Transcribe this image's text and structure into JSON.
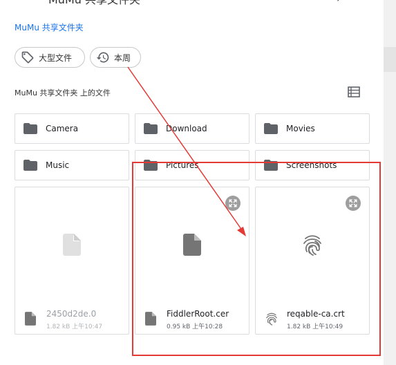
{
  "header": {
    "title": "MuMu 共享文件夹",
    "root_link": "MuMu 共享文件夹",
    "close_glyph": "↗"
  },
  "chips": [
    {
      "label": "大型文件",
      "icon": "tag-icon"
    },
    {
      "label": "本周",
      "icon": "history-icon"
    }
  ],
  "section": {
    "label": "MuMu 共享文件夹 上的文件",
    "view_toggle_icon": "list-view-icon"
  },
  "folders": [
    {
      "label": "Camera"
    },
    {
      "label": "Download"
    },
    {
      "label": "Movies"
    },
    {
      "label": "Music"
    },
    {
      "label": "Pictures"
    },
    {
      "label": "Screenshots"
    }
  ],
  "files": [
    {
      "name": "2450d2de.0",
      "meta": "1.82 kB 上午10:47",
      "icon": "document-icon",
      "enabled": false
    },
    {
      "name": "FiddlerRoot.cer",
      "meta": "0.95 kB 上午10:28",
      "icon": "document-icon",
      "enabled": true
    },
    {
      "name": "reqable-ca.crt",
      "meta": "1.82 kB 上午10:49",
      "icon": "fingerprint-icon",
      "enabled": true
    }
  ],
  "colors": {
    "accent": "#1a73e8",
    "annotation": "#e53935",
    "folder_icon": "#5f6368"
  }
}
